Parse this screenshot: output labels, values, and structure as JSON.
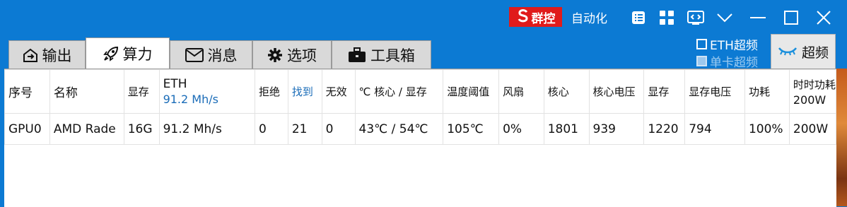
{
  "header": {
    "brand": "群控",
    "automation": "自动化",
    "colors": {
      "background": "#0c7ad3",
      "brand": "#e01b1b",
      "link": "#1a6cb8"
    },
    "icons": [
      "s-logo-icon",
      "notes-icon",
      "grid-icon",
      "code-icon",
      "chevron-down-icon",
      "minimize-icon",
      "maximize-icon",
      "close-icon"
    ]
  },
  "tabs": [
    {
      "label": "输出",
      "icon": "output-icon"
    },
    {
      "label": "算力",
      "icon": "rocket-icon",
      "active": true
    },
    {
      "label": "消息",
      "icon": "mail-icon"
    },
    {
      "label": "选项",
      "icon": "gear-icon"
    },
    {
      "label": "工具箱",
      "icon": "toolbox-icon"
    }
  ],
  "overclock": {
    "eth": "ETH超频",
    "single": "单卡超频",
    "button": "超频"
  },
  "table": {
    "headers": {
      "index": "序号",
      "name": "名称",
      "mem": "显存",
      "eth": "ETH",
      "eth_rate": "91.2 Mh/s",
      "reject": "拒绝",
      "found": "找到",
      "invalid": "无效",
      "temp": "℃ 核心 / 显存",
      "temp_limit": "温度阈值",
      "fan": "风扇",
      "core": "核心",
      "core_volt": "核心电压",
      "mem2": "显存",
      "mem_volt": "显存电压",
      "power": "功耗",
      "eff": "时时功耗",
      "eff_val": "200W"
    },
    "rows": [
      {
        "index": "GPU0",
        "name": "AMD Rade",
        "mem": "16G",
        "eth": "91.2 Mh/s",
        "reject": "0",
        "found": "21",
        "invalid": "0",
        "temp": "43℃ / 54℃",
        "temp_limit": "105℃",
        "fan": "0%",
        "core": "1801",
        "core_volt": "939",
        "mem_clock": "1220",
        "mem_volt": "794",
        "power": "100%",
        "eff": "200W"
      }
    ]
  }
}
